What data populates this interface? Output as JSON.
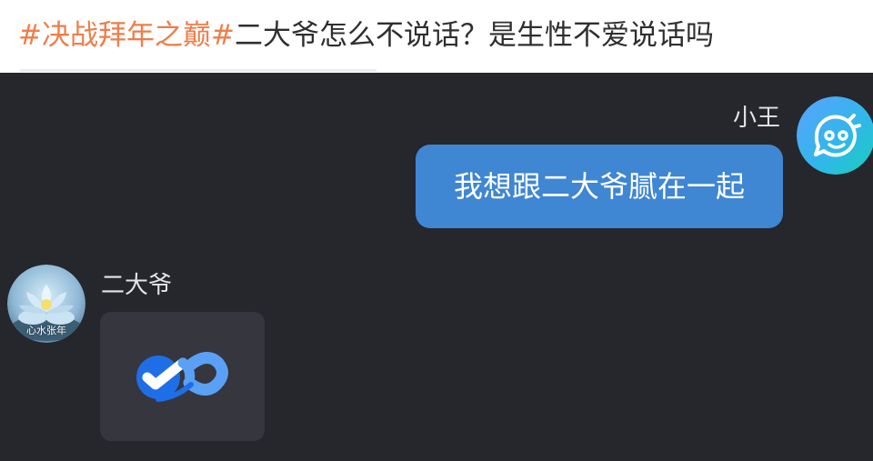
{
  "title": {
    "hashtag": "#决战拜年之巅#",
    "question": "二大爷怎么不说话？是生性不爱说话吗"
  },
  "messages": [
    {
      "sender": "小王",
      "side": "right",
      "text": "我想跟二大爷腻在一起",
      "bubble_color": "#3f86d3",
      "avatar_icon": "chat-bot-icon"
    },
    {
      "sender": "二大爷",
      "side": "left",
      "content_type": "app-card",
      "card_icon": "infinity-logo-icon",
      "avatar_icon": "lotus-avatar",
      "avatar_caption": "心水张年"
    }
  ],
  "colors": {
    "chat_background": "#26262d",
    "hashtag": "#ef7d4a",
    "card_background": "#36363e",
    "logo_primary": "#1e6ee8",
    "logo_secondary": "#5aa0f5"
  }
}
